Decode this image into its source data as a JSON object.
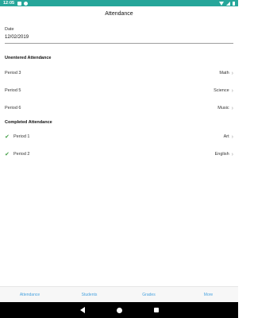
{
  "status_bar": {
    "time": "12:05"
  },
  "header": {
    "title": "Attendance"
  },
  "date": {
    "label": "Date",
    "value": "12/02/2019"
  },
  "unentered": {
    "heading": "Unentered Attendance",
    "rows": [
      {
        "period": "Period 3",
        "subject": "Math"
      },
      {
        "period": "Period 5",
        "subject": "Science"
      },
      {
        "period": "Period 6",
        "subject": "Music"
      }
    ]
  },
  "completed": {
    "heading": "Completed Attendance",
    "rows": [
      {
        "period": "Period 1",
        "subject": "Art"
      },
      {
        "period": "Period 2",
        "subject": "English"
      }
    ]
  },
  "bottom_nav": [
    "Attendance",
    "Students",
    "Grades",
    "More"
  ],
  "colors": {
    "accent": "#26a69a",
    "nav_text": "#4aa3df",
    "check": "#43a047"
  },
  "icons": {
    "check": "check-icon",
    "chevron": "chevron-right-icon",
    "back": "back-icon",
    "home": "home-icon",
    "recents": "recents-icon"
  }
}
